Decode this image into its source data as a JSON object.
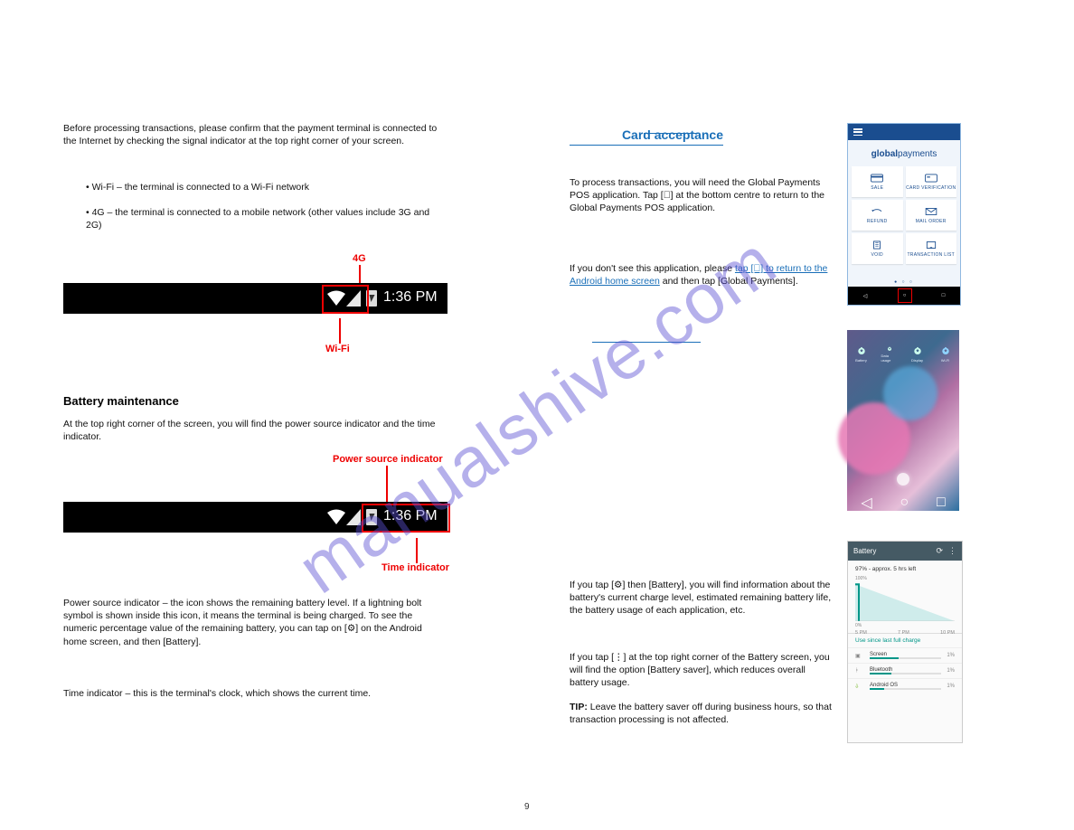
{
  "watermark": "manualshive.com",
  "left_column": {
    "p0": "Before processing transactions, please confirm that the payment terminal is connected to the Internet by checking the signal indicator at the top right corner of your screen.",
    "li1": "Wi-Fi – the terminal is connected to a Wi-Fi network",
    "li2": "4G – the terminal is connected to a mobile network (other values include 3G and 2G)",
    "h1": "Battery maintenance",
    "p1": "At the top right corner of the screen, you will find the power source indicator and the time indicator.",
    "p2a": "Power source indicator – the icon shows the remaining battery level. If a lightning bolt symbol is shown inside this icon, it means the terminal is being charged. To see the numeric percentage value of the remaining battery, you can tap on ",
    "p2b": " on the Android home screen, and then [Battery].",
    "p3": "Time indicator – this is the terminal's clock, which shows the current time."
  },
  "right_column": {
    "heading": "Card acceptance",
    "p2": "To process transactions, you will need the Global Payments POS application. Tap [⃝] at the bottom centre to return to the Global Payments POS application.",
    "p3": "If you don't see this application, please",
    "p3_link": "tap [⃝] to return to the Android home screen",
    "p3b": "and then tap [Global Payments].",
    "battery_note1": "If you tap [⚙] then [Battery], you will find information about the battery's current charge level, estimated remaining battery life, the battery usage of each application, etc.",
    "battery_note2": "If you tap [⋮] at the top right corner of the Battery screen, you will find the option [Battery saver], which reduces overall battery usage.",
    "battery_note3a": "TIP: ",
    "battery_note3b": " Leave the battery saver off during business hours, so that transaction processing is not affected."
  },
  "statusbar": {
    "time": "1:36 PM",
    "label_4g": "4G",
    "label_wifi": "Wi-Fi",
    "label_power": "Power source indicator",
    "label_time": "Time indicator"
  },
  "phone_app": {
    "logo_bold": "global",
    "logo_light": "payments",
    "tiles": {
      "sale": "SALE",
      "cardv": "CARD VERIFICATION",
      "refund": "REFUND",
      "mail": "MAIL ORDER",
      "void": "VOID",
      "txn": "TRANSACTION LIST"
    },
    "dots": "● ○ ○"
  },
  "phone_home": {
    "icons": [
      "Battery",
      "Data usage",
      "Display",
      "Wi-Fi"
    ]
  },
  "phone_battery": {
    "title": "Battery",
    "sub": "97% - approx. 5 hrs left",
    "y100": "100%",
    "y0": "0%",
    "x1": "5 PM",
    "x2": "7 PM",
    "x3": "10 PM",
    "section": "Use since last full charge",
    "rows": {
      "screen": "Screen",
      "bt": "Bluetooth",
      "os": "Android OS"
    },
    "pct": "1%"
  },
  "page_number": "9"
}
